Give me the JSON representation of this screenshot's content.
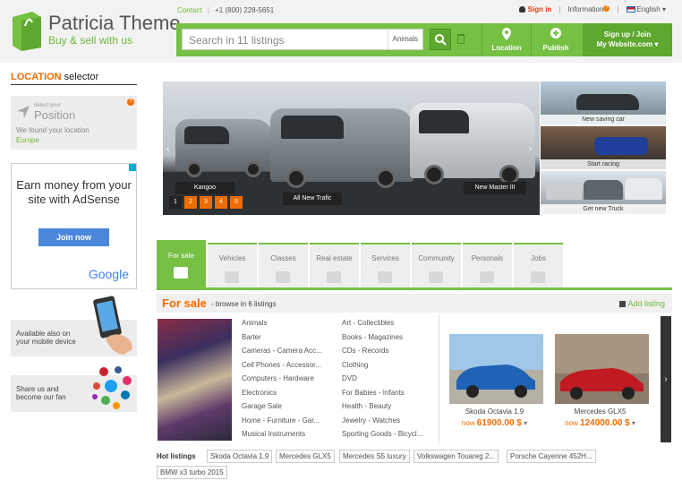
{
  "brand": {
    "title": "Patricia Theme",
    "subtitle": "Buy & sell with us",
    "accent": "#76c043",
    "orange": "#ef6c00"
  },
  "contact": {
    "link": "Contact",
    "phone": "+1 (800) 228-5651"
  },
  "toplinks": {
    "signin": "Sign in",
    "information": "Information",
    "info_badge": "?",
    "language": "English"
  },
  "search": {
    "placeholder": "Search in 11 listings",
    "category": "Animals"
  },
  "nav": {
    "location": "Location",
    "publish": "Publish",
    "signup": "Sign up / Join",
    "website": "My Website.com"
  },
  "location_selector": {
    "title_accent": "LOCATION",
    "title_rest": " selector",
    "detect_small": "detect your",
    "detect_big": "Position",
    "found_text": "We found your location",
    "region": "Europe",
    "help": "?"
  },
  "ad": {
    "text": "Earn money from your site with AdSense",
    "button": "Join now",
    "brand": "Google"
  },
  "promos": {
    "mobile": "Available also on your mobile device",
    "social": "Share us and become our fan"
  },
  "slider": {
    "captions": [
      "Kangoo",
      "All New Trafic",
      "New Master III"
    ],
    "pages": [
      "1",
      "2",
      "3",
      "4",
      "5"
    ],
    "prev": "‹",
    "next": "›"
  },
  "thumbs": [
    "New saving car",
    "Start racing",
    "Get new Truck"
  ],
  "tabs": [
    "For sale",
    "Vehicles",
    "Classes",
    "Real estate",
    "Services",
    "Community",
    "Personals",
    "Jobs"
  ],
  "forsale": {
    "title": "For sale",
    "browse": "- browse in 6 listings",
    "add": "Add listing"
  },
  "categories_left": [
    "Animals",
    "Barter",
    "Cameras - Camera Acc...",
    "Cell Phones - Accessor...",
    "Computers - Hardware",
    "Electronics",
    "Garage Sale",
    "Home - Furniture - Gar...",
    "Musical Instruments"
  ],
  "categories_right": [
    "Art - Collectibles",
    "Books - Magazines",
    "CDs - Records",
    "Clothing",
    "DVD",
    "For Babies - Infants",
    "Health - Beauty",
    "Jewelry - Watches",
    "Sporting Goods - Bicycl..."
  ],
  "cars": [
    {
      "name": "Skoda Octavia 1.9",
      "price_prefix": "now",
      "price": "61900.00 $",
      "color": "#1e63b5"
    },
    {
      "name": "Mercedes GLX5",
      "price_prefix": "now",
      "price": "124000.00 $",
      "color": "#c01a22"
    }
  ],
  "next": "›",
  "hot": {
    "label": "Hot listings",
    "items": [
      "Skoda Octavia 1.9",
      "Mercedes GLX5",
      "Mercedes S5 luxury",
      "Volkswagen Touareg 2...",
      "Porsche Cayenne 452H...",
      "BMW x3 turbo 2015"
    ]
  }
}
